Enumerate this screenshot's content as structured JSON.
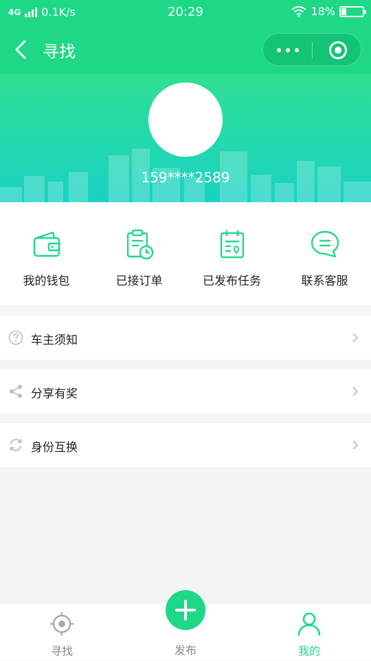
{
  "status_bar": {
    "network": "4G",
    "speed": "0.1K/s",
    "time": "20:29",
    "battery": "18%"
  },
  "nav": {
    "title": "寻找"
  },
  "profile": {
    "phone": "159****2589"
  },
  "quick_actions": [
    {
      "label": "我的钱包",
      "icon": "wallet-icon"
    },
    {
      "label": "已接订单",
      "icon": "clipboard-clock-icon"
    },
    {
      "label": "已发布任务",
      "icon": "calendar-pin-icon"
    },
    {
      "label": "联系客服",
      "icon": "chat-bubble-icon"
    }
  ],
  "menu": [
    {
      "label": "车主须知",
      "icon": "question-icon"
    },
    {
      "label": "分享有奖",
      "icon": "share-icon"
    },
    {
      "label": "身份互换",
      "icon": "refresh-icon"
    }
  ],
  "tabs": [
    {
      "label": "寻找",
      "icon": "locate-icon",
      "active": false
    },
    {
      "label": "发布",
      "icon": "plus-icon",
      "active": false
    },
    {
      "label": "我的",
      "icon": "user-icon",
      "active": true
    }
  ],
  "colors": {
    "brand": "#1ed886",
    "accent_teal": "#19d2c4",
    "icon_green": "#1ed886"
  }
}
